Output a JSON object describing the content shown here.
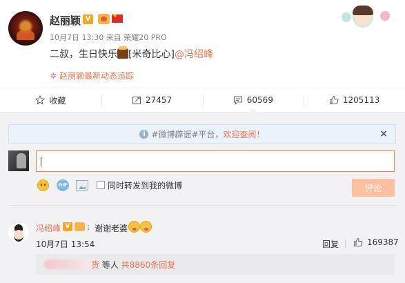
{
  "post": {
    "username": "赵丽颖",
    "v_badge": "V",
    "date": "10月7日 13:30",
    "source_prefix": "来自",
    "source": "荣耀20 PRO",
    "text_before": "二叔，生日快乐",
    "text_tag": "[米奇比心]",
    "mention": "@冯绍峰",
    "tracking_link": "赵丽颖最新动态追踪"
  },
  "actions": {
    "favorite_label": "收藏",
    "repost_count": "27457",
    "comment_count": "60569",
    "like_count": "1205113"
  },
  "notice": {
    "prefix": "#微博辟谣#平台，",
    "welcome": "欢迎查阅！",
    "close": "×"
  },
  "composer": {
    "input_value": "",
    "repost_checkbox_label": "同时转发到我的微博",
    "submit_label": "评论",
    "gif_label": "GIF"
  },
  "comment": {
    "name": "冯绍峰",
    "v_badge": "V",
    "separator": ":",
    "text": "谢谢老婆",
    "time": "10月7日 13:54",
    "reply_label": "回复",
    "like_count": "169387",
    "sub_replies": {
      "name_tail": "货",
      "middle": " 等人 ",
      "more": "共8860条回复"
    }
  },
  "colors": {
    "accent": "#eb7350",
    "input_border": "#fa7d3c",
    "submit_disabled": "#ffc09f",
    "comment_bg": "#f2f2f5",
    "notice_bg": "#eaf2fa"
  }
}
